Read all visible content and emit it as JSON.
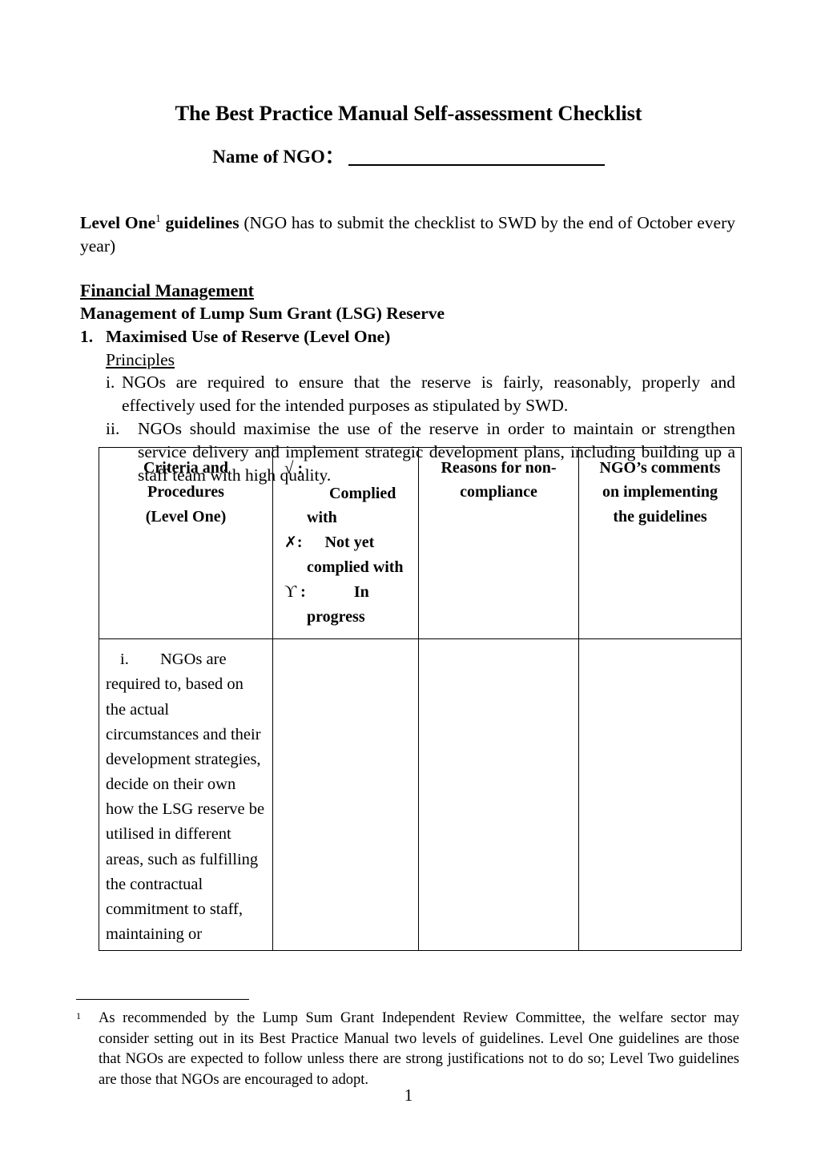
{
  "document": {
    "title": "The Best Practice Manual Self-assessment Checklist",
    "ngo_name_label": "Name of NGO：",
    "page_number": "1"
  },
  "intro": {
    "level_one_bold": "Level One",
    "footnote_marker": "1",
    "guidelines_bold": " guidelines ",
    "rest": "(NGO has to submit the checklist to SWD by the end of October every year)"
  },
  "sections": {
    "financial_management": "Financial Management",
    "lsg_reserve": "Management of Lump Sum Grant (LSG) Reserve",
    "item_number": "1.",
    "item_title": "Maximised Use of Reserve (Level One)",
    "principles_label": "Principles",
    "principles": [
      {
        "mark": "i.",
        "text": "NGOs are required to ensure that the reserve is fairly, reasonably, properly and effectively used for the intended purposes as stipulated by SWD."
      },
      {
        "mark": "ii.",
        "text": "NGOs should maximise the use of the reserve in order to maintain or strengthen service delivery and implement strategic development plans, including building up a staff team with high quality."
      }
    ]
  },
  "table": {
    "headers": {
      "criteria": "Criteria and Procedures (Level One)",
      "criteria_lines": [
        "Criteria and",
        "Procedures",
        "(Level One)"
      ],
      "symbols": {
        "check_glyph": "√",
        "check_label": "Complied with",
        "x_glyph": "✗",
        "x_label_part1": "Not yet",
        "x_label_part2": "complied with",
        "ups_glyph": "ϒ",
        "ups_label_part1": "In",
        "ups_label_part2": "progress",
        "colon": ":"
      },
      "reasons": "Reasons for non-compliance",
      "reasons_lines": [
        "Reasons for non-",
        "compliance"
      ],
      "comments": "NGO’s comments on implementing the guidelines",
      "comments_lines": [
        "NGO’s comments",
        "on implementing",
        "the guidelines"
      ]
    },
    "rows": [
      {
        "mark": "i.",
        "criteria": "NGOs are required to, based on the actual circumstances and their development strategies, decide on their own how the LSG reserve be utilised in different areas, such as fulfilling the contractual commitment to staff, maintaining or",
        "compliance": "",
        "reasons": "",
        "comments": ""
      }
    ]
  },
  "footnote": {
    "number": "1",
    "text": "As recommended by the Lump Sum Grant Independent Review Committee, the welfare sector may consider setting out in its Best Practice Manual two levels of guidelines.  Level One guidelines are those that NGOs are expected to follow unless there are strong justifications not to do so; Level Two guidelines are those that NGOs are encouraged to adopt."
  }
}
